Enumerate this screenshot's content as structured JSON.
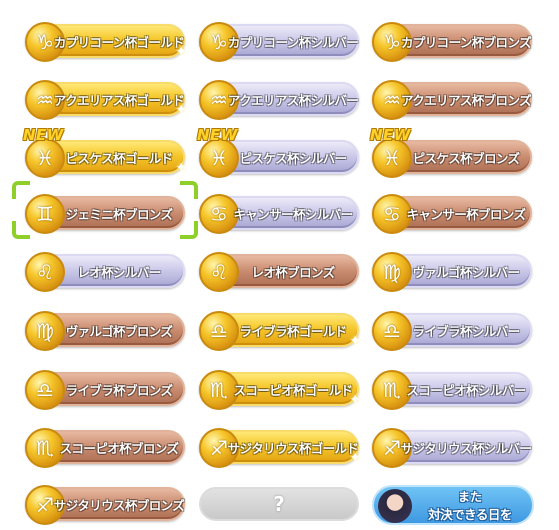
{
  "colors": {
    "gold": "#f5c72b",
    "silver": "#c9c7e8",
    "bronze": "#c98c70",
    "new_tag": "#ffd22a",
    "selector": "#8fcf2a",
    "promo": "#3f99e2"
  },
  "badges": [
    {
      "label": "カプリコーン杯ゴールド",
      "tier": "gold",
      "icon": "capricorn-icon",
      "new": false
    },
    {
      "label": "カプリコーン杯シルバー",
      "tier": "silver",
      "icon": "capricorn-icon",
      "new": false
    },
    {
      "label": "カプリコーン杯ブロンズ",
      "tier": "bronze",
      "icon": "capricorn-icon",
      "new": false
    },
    {
      "label": "アクエリアス杯ゴールド",
      "tier": "gold",
      "icon": "aquarius-icon",
      "new": false
    },
    {
      "label": "アクエリアス杯シルバー",
      "tier": "silver",
      "icon": "aquarius-icon",
      "new": false
    },
    {
      "label": "アクエリアス杯ブロンズ",
      "tier": "bronze",
      "icon": "aquarius-icon",
      "new": false
    },
    {
      "label": "ピスケス杯ゴールド",
      "tier": "gold",
      "icon": "pisces-icon",
      "new": true
    },
    {
      "label": "ピスケス杯シルバー",
      "tier": "silver",
      "icon": "pisces-icon",
      "new": true
    },
    {
      "label": "ピスケス杯ブロンズ",
      "tier": "bronze",
      "icon": "pisces-icon",
      "new": true
    },
    {
      "label": "ジェミニ杯ブロンズ",
      "tier": "bronze",
      "icon": "gemini-icon",
      "new": false,
      "selected": true
    },
    {
      "label": "キャンサー杯シルバー",
      "tier": "silver",
      "icon": "cancer-icon",
      "new": false
    },
    {
      "label": "キャンサー杯ブロンズ",
      "tier": "bronze",
      "icon": "cancer-icon",
      "new": false
    },
    {
      "label": "レオ杯シルバー",
      "tier": "silver",
      "icon": "leo-icon",
      "new": false
    },
    {
      "label": "レオ杯ブロンズ",
      "tier": "bronze",
      "icon": "leo-icon",
      "new": false
    },
    {
      "label": "ヴァルゴ杯シルバー",
      "tier": "silver",
      "icon": "virgo-icon",
      "new": false
    },
    {
      "label": "ヴァルゴ杯ブロンズ",
      "tier": "bronze",
      "icon": "virgo-icon",
      "new": false
    },
    {
      "label": "ライブラ杯ゴールド",
      "tier": "gold",
      "icon": "libra-icon",
      "new": false
    },
    {
      "label": "ライブラ杯シルバー",
      "tier": "silver",
      "icon": "libra-icon",
      "new": false
    },
    {
      "label": "ライブラ杯ブロンズ",
      "tier": "bronze",
      "icon": "libra-icon",
      "new": false
    },
    {
      "label": "スコーピオ杯ゴールド",
      "tier": "gold",
      "icon": "scorpio-icon",
      "new": false
    },
    {
      "label": "スコーピオ杯シルバー",
      "tier": "silver",
      "icon": "scorpio-icon",
      "new": false
    },
    {
      "label": "スコーピオ杯ブロンズ",
      "tier": "bronze",
      "icon": "scorpio-icon",
      "new": false
    },
    {
      "label": "サジタリウス杯ゴールド",
      "tier": "gold",
      "icon": "sagittarius-icon",
      "new": false
    },
    {
      "label": "サジタリウス杯シルバー",
      "tier": "silver",
      "icon": "sagittarius-icon",
      "new": false
    },
    {
      "label": "サジタリウス杯ブロンズ",
      "tier": "bronze",
      "icon": "sagittarius-icon",
      "new": false
    }
  ],
  "new_label": "NEW",
  "unknown_badge": {
    "label": "?"
  },
  "promo": {
    "line1": "また",
    "line2": "対決できる日を"
  }
}
